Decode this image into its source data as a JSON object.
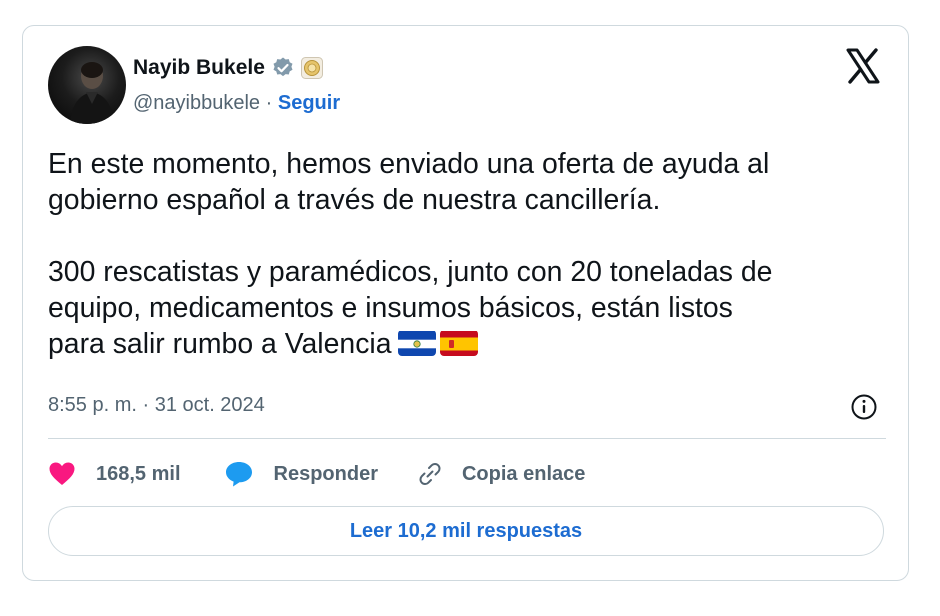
{
  "author": {
    "name": "Nayib Bukele",
    "handle": "@nayibbukele",
    "separator": "·",
    "follow_label": "Seguir"
  },
  "tweet": {
    "paragraph1_line1": "En este momento, hemos enviado una oferta de ayuda al",
    "paragraph1_line2": "gobierno español a través de nuestra cancillería.",
    "paragraph2_line1": "300 rescatistas y paramédicos, junto con 20 toneladas de",
    "paragraph2_line2": "equipo, medicamentos e insumos básicos, están listos",
    "paragraph2_line3": "para salir rumbo a Valencia",
    "flags": [
      "el-salvador-flag",
      "spain-flag"
    ],
    "timestamp": "8:55 p. m. · 31 oct. 2024"
  },
  "actions": {
    "likes": "168,5 mil",
    "reply_label": "Responder",
    "copy_label": "Copia enlace"
  },
  "replies_button": "Leer 10,2 mil respuestas",
  "icons": {
    "verified": "verified-badge-icon",
    "government": "government-seal-icon",
    "logo": "x-logo-icon",
    "info": "info-icon",
    "like": "heart-icon",
    "reply": "speech-bubble-icon",
    "copy": "link-icon"
  },
  "colors": {
    "accent": "#1d6cd1",
    "heart": "#f91880",
    "muted": "#536471",
    "border": "#cfd9de",
    "text": "#0f1419"
  }
}
